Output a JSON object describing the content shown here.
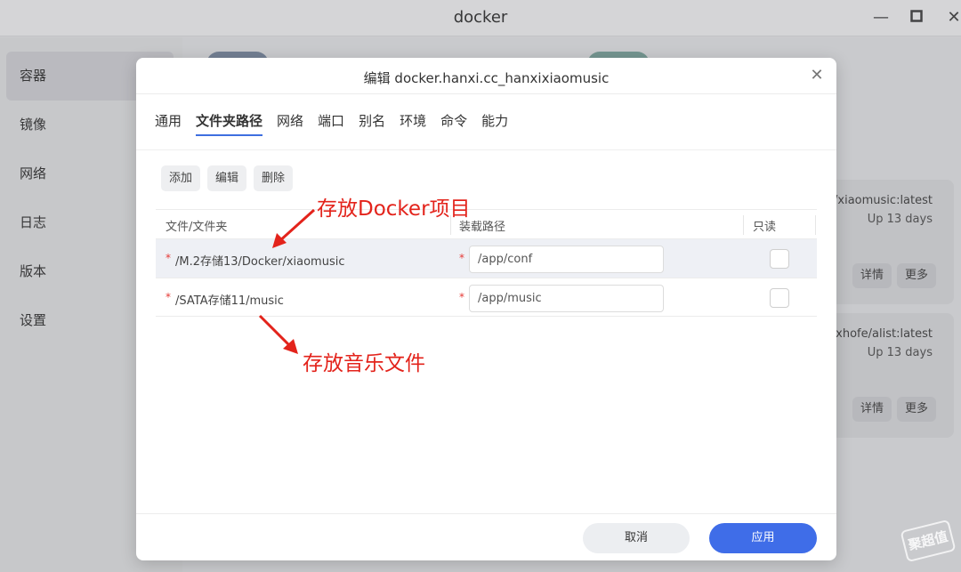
{
  "window": {
    "title": "docker"
  },
  "sidebar": {
    "items": [
      {
        "label": "容器"
      },
      {
        "label": "镜像"
      },
      {
        "label": "网络"
      },
      {
        "label": "日志"
      },
      {
        "label": "版本"
      },
      {
        "label": "设置"
      }
    ],
    "active": "容器"
  },
  "background": {
    "containers": [
      {
        "image": "xi/xiaomusic:latest",
        "status": "Up 13 days",
        "detail": "详情",
        "more": "更多"
      },
      {
        "image": "xhofe/alist:latest",
        "status": "Up 13 days",
        "detail": "详情",
        "more": "更多"
      }
    ]
  },
  "dialog": {
    "title": "编辑 docker.hanxi.cc_hanxixiaomusic",
    "tabs": [
      "通用",
      "文件夹路径",
      "网络",
      "端口",
      "别名",
      "环境",
      "命令",
      "能力"
    ],
    "active_tab": "文件夹路径",
    "toolbar": {
      "add": "添加",
      "edit": "编辑",
      "delete": "删除"
    },
    "table": {
      "headers": {
        "file": "文件/文件夹",
        "mount": "装载路径",
        "readonly": "只读"
      },
      "rows": [
        {
          "required": "*",
          "path": "/M.2存储13/Docker/xiaomusic",
          "mount": "/app/conf",
          "readonly": false
        },
        {
          "required": "*",
          "path": "/SATA存储11/music",
          "mount": "/app/music",
          "readonly": false
        }
      ]
    },
    "footer": {
      "cancel": "取消",
      "apply": "应用"
    }
  },
  "annotations": {
    "docker_label": "存放Docker项目",
    "music_label": "存放音乐文件",
    "color": "#e3231b"
  },
  "watermark": "聚超值",
  "colors": {
    "accent": "#3f6de8",
    "required": "#e53935"
  }
}
